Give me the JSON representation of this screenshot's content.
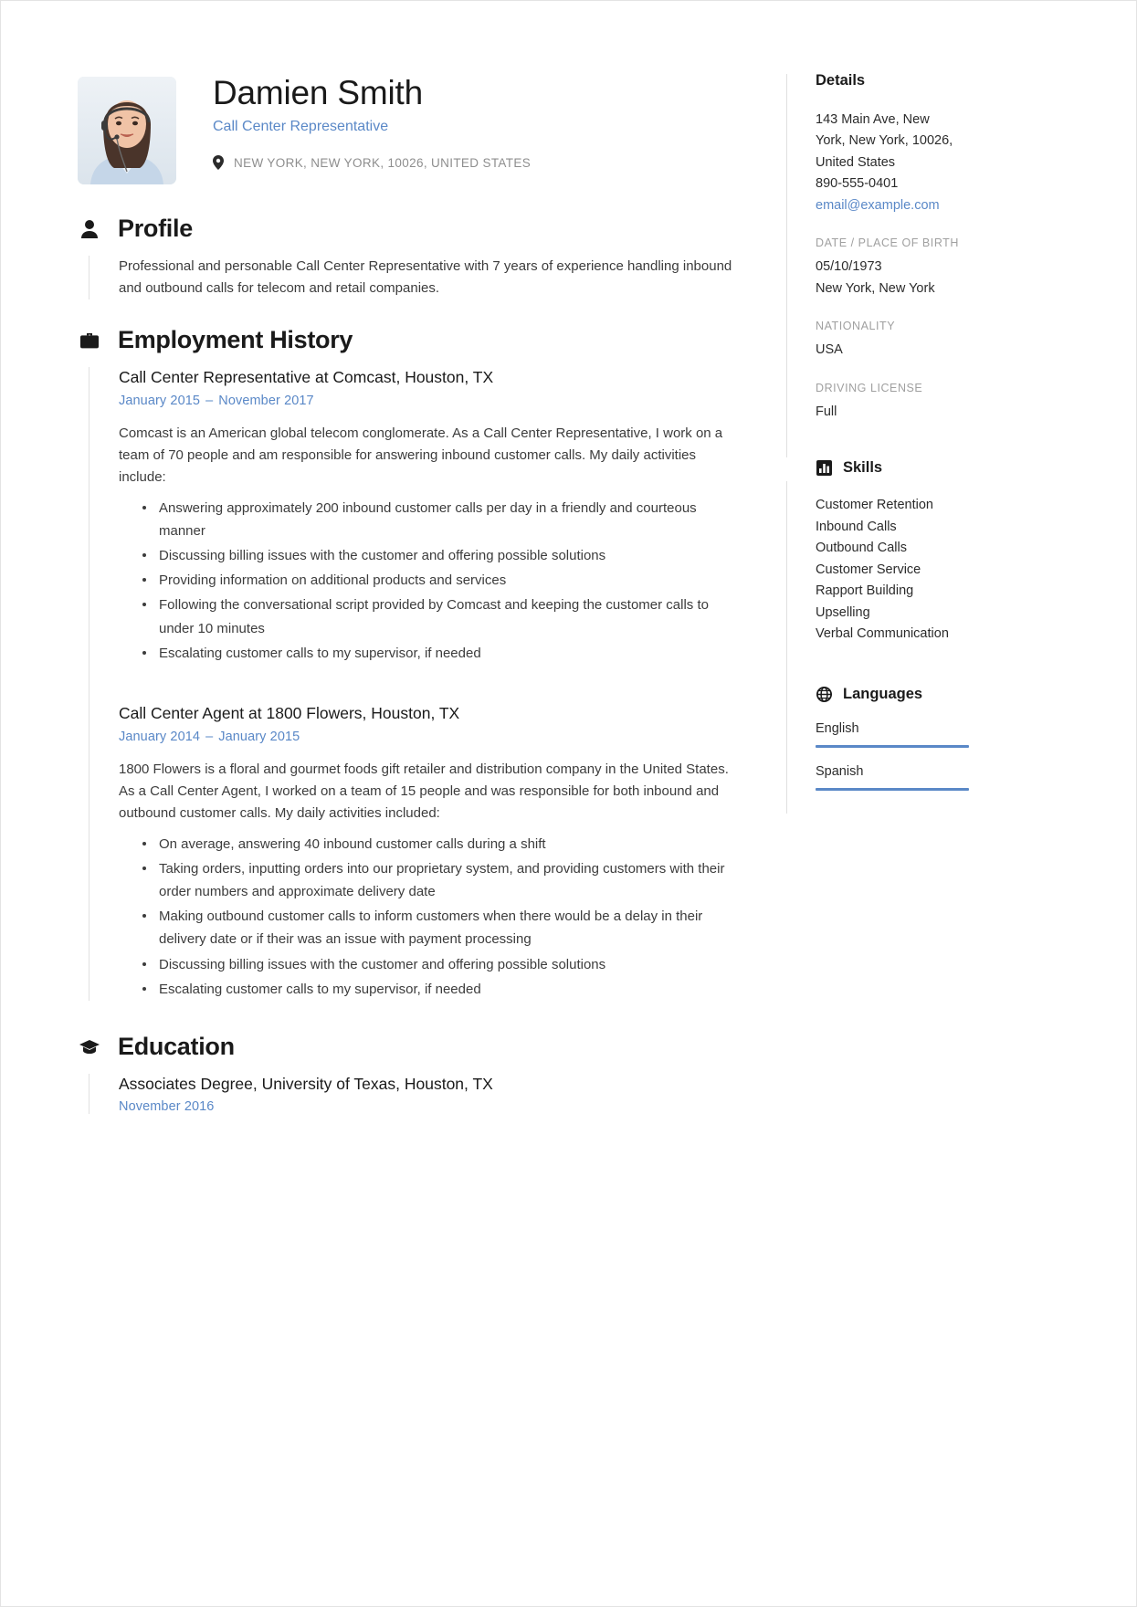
{
  "header": {
    "name": "Damien Smith",
    "job_title": "Call Center Representative",
    "location": "NEW YORK, NEW YORK, 10026, UNITED STATES",
    "avatar_alt": "portrait-photo",
    "pin_icon": "map-pin-icon"
  },
  "sections": {
    "profile": {
      "icon": "person-icon",
      "title": "Profile",
      "text": "Professional and personable Call Center Representative with 7 years of experience handling inbound and outbound calls for telecom and retail companies."
    },
    "employment": {
      "icon": "briefcase-icon",
      "title": "Employment History",
      "entries": [
        {
          "title": "Call Center Representative at Comcast, Houston, TX",
          "date_start": "January 2015",
          "date_sep": "–",
          "date_end": "November 2017",
          "summary": "Comcast is an American global telecom conglomerate. As a Call Center Representative, I work on a team of 70 people and am responsible for answering inbound customer calls. My daily activities include:",
          "bullets": [
            "Answering approximately 200 inbound customer calls per day in a friendly and courteous manner",
            "Discussing billing issues with the customer and offering possible solutions",
            "Providing information on additional products and services",
            "Following the conversational script provided by Comcast and keeping the customer calls to under 10 minutes",
            "Escalating customer calls to my supervisor, if needed"
          ]
        },
        {
          "title": "Call Center Agent at 1800 Flowers, Houston, TX",
          "date_start": "January 2014",
          "date_sep": "–",
          "date_end": "January 2015",
          "summary": "1800 Flowers is a floral and gourmet foods gift retailer and distribution company in the United States. As a Call Center Agent, I worked on a team of 15 people and was responsible for both inbound and outbound customer calls. My daily activities included:",
          "bullets": [
            "On average, answering 40 inbound customer calls during a shift",
            "Taking orders, inputting orders into our proprietary system, and providing customers with their order numbers and approximate delivery date",
            "Making outbound customer calls to inform customers when there would be a delay in their delivery date or if their was an issue with payment processing",
            "Discussing billing issues with the customer and offering possible solutions",
            "Escalating customer calls to my supervisor, if needed"
          ]
        }
      ]
    },
    "education": {
      "icon": "graduation-cap-icon",
      "title": "Education",
      "entries": [
        {
          "title": "Associates Degree, University of Texas, Houston, TX",
          "date": "November 2016"
        }
      ]
    }
  },
  "sidebar": {
    "details": {
      "title": "Details",
      "address_lines": [
        "143 Main Ave, New",
        "York, New York, 10026,",
        "United States"
      ],
      "phone": "890-555-0401",
      "email": "email@example.com",
      "fields": [
        {
          "label": "DATE / PLACE OF BIRTH",
          "values": [
            "05/10/1973",
            "New York, New York"
          ]
        },
        {
          "label": "NATIONALITY",
          "values": [
            "USA"
          ]
        },
        {
          "label": "DRIVING LICENSE",
          "values": [
            "Full"
          ]
        }
      ]
    },
    "skills": {
      "icon": "bar-chart-icon",
      "title": "Skills",
      "items": [
        "Customer Retention",
        "Inbound Calls",
        "Outbound Calls",
        "Customer Service",
        "Rapport Building",
        "Upselling",
        "Verbal Communication"
      ]
    },
    "languages": {
      "icon": "globe-icon",
      "title": "Languages",
      "items": [
        {
          "name": "English",
          "level": 100
        },
        {
          "name": "Spanish",
          "level": 100
        }
      ]
    }
  },
  "colors": {
    "accent": "#5a88c7",
    "text": "#2b2b2b",
    "muted": "#a0a0a0",
    "rule": "#e0e0e0"
  }
}
